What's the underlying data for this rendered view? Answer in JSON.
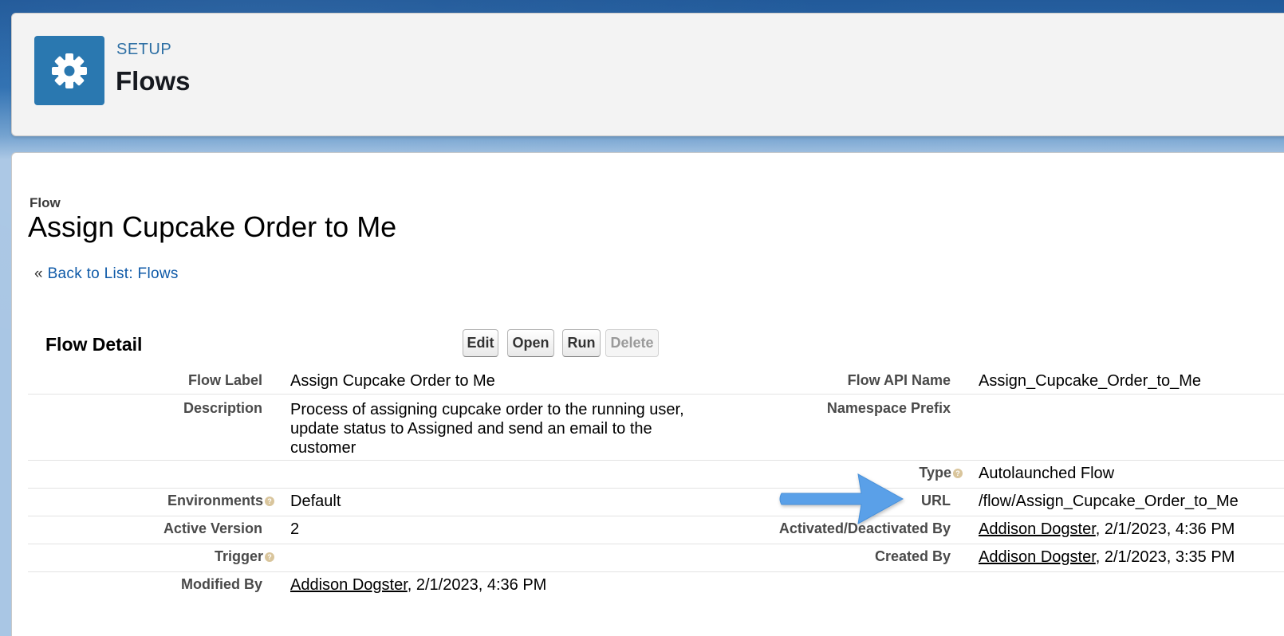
{
  "header": {
    "caption": "SETUP",
    "title": "Flows",
    "icon": "gear-icon"
  },
  "record": {
    "type": "Flow",
    "title": "Assign Cupcake Order to Me",
    "back_prefix": "«",
    "back_link": "Back to List: Flows"
  },
  "detail": {
    "section_title": "Flow Detail",
    "buttons": {
      "edit": "Edit",
      "open": "Open",
      "run": "Run",
      "delete": "Delete"
    },
    "left": {
      "flow_label": {
        "label": "Flow Label",
        "value": "Assign Cupcake Order to Me"
      },
      "description": {
        "label": "Description",
        "value": "Process of assigning cupcake order to the running user, update status to Assigned and send an email to the customer"
      },
      "environments": {
        "label": "Environments",
        "value": "Default"
      },
      "active_version": {
        "label": "Active Version",
        "value": "2"
      },
      "trigger": {
        "label": "Trigger",
        "value": ""
      },
      "modified_by": {
        "label": "Modified By",
        "user": "Addison Dogster",
        "date": ", 2/1/2023, 4:36 PM"
      }
    },
    "right": {
      "api_name": {
        "label": "Flow API Name",
        "value": "Assign_Cupcake_Order_to_Me"
      },
      "namespace_prefix": {
        "label": "Namespace Prefix",
        "value": ""
      },
      "type": {
        "label": "Type",
        "value": "Autolaunched Flow"
      },
      "url": {
        "label": "URL",
        "value": "/flow/Assign_Cupcake_Order_to_Me"
      },
      "activated_by": {
        "label": "Activated/Deactivated By",
        "user": "Addison Dogster",
        "date": ", 2/1/2023, 4:36 PM"
      },
      "created_by": {
        "label": "Created By",
        "user": "Addison Dogster",
        "date": ", 2/1/2023, 3:35 PM"
      }
    }
  },
  "colors": {
    "accent": "#2a78b0",
    "link": "#0f5aa8",
    "arrow": "#5aa0e8"
  }
}
